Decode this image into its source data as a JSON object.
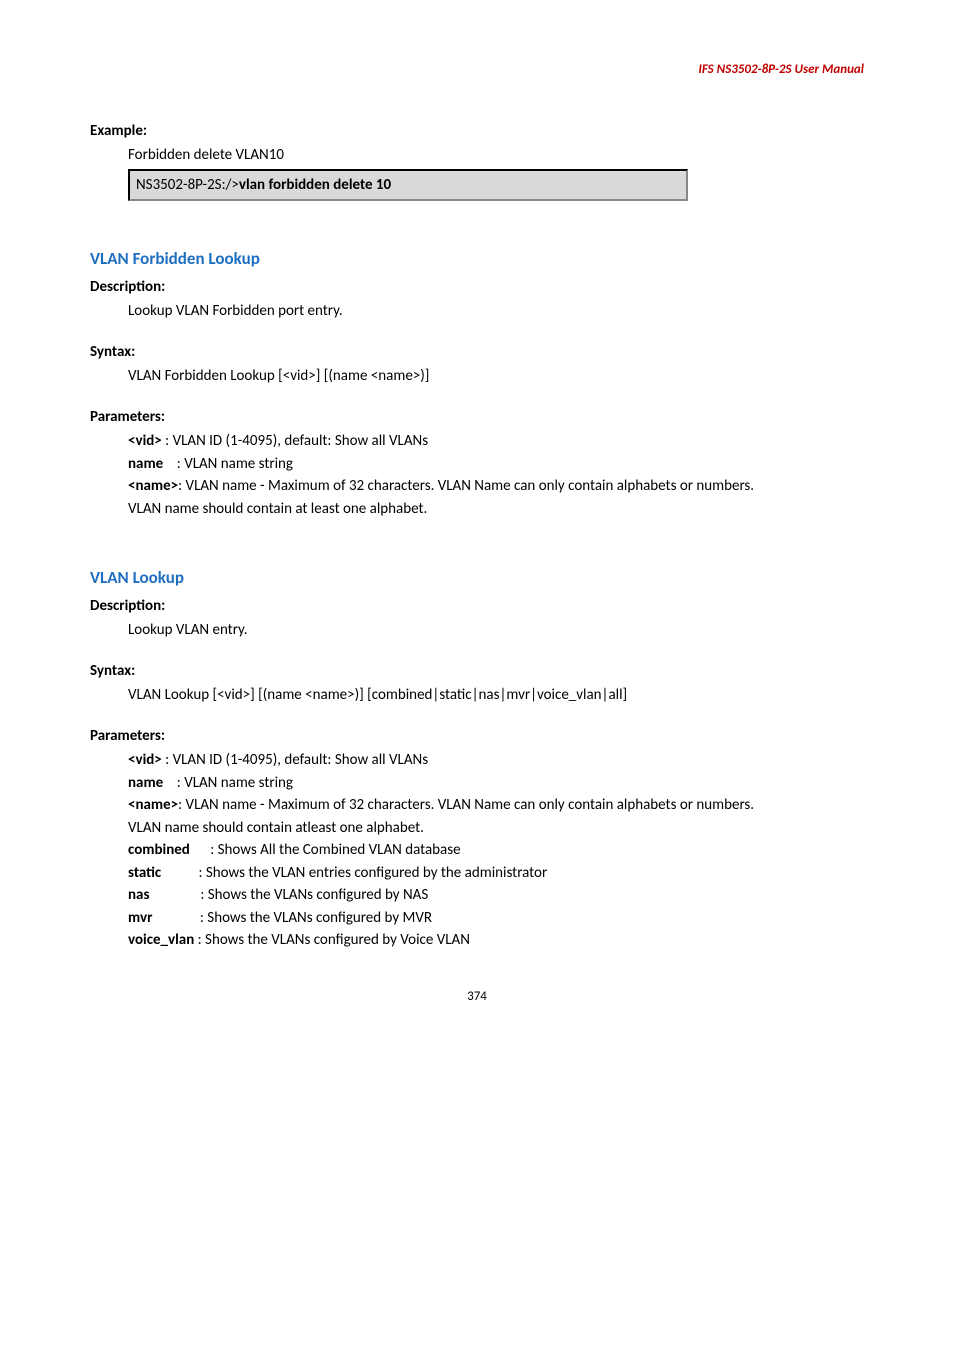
{
  "header": "IFS  NS3502-8P-2S  User  Manual",
  "exampleLabel": "Example:",
  "exampleText": "Forbidden delete VLAN10",
  "codeBoxPrefix": "NS3502-8P-2S:/>",
  "codeBoxCmd": "vlan forbidden delete 10",
  "sec1": {
    "title": "VLAN Forbidden Lookup",
    "descLabel": "Description:",
    "descText": "Lookup VLAN Forbidden port entry.",
    "syntaxLabel": "Syntax:",
    "syntaxText": "VLAN Forbidden Lookup [<vid>] [(name <name>)]",
    "paramLabel": "Parameters:",
    "p1k": "<vid>",
    "p1v": " : VLAN ID (1-4095), default: Show all VLANs",
    "p2k": "name",
    "p2v": "    : VLAN name string",
    "p3k": "<name>",
    "p3v": ": VLAN name - Maximum of 32 characters. VLAN Name can only contain alphabets or numbers.",
    "p4": "VLAN name should contain at least one alphabet."
  },
  "sec2": {
    "title": "VLAN Lookup",
    "descLabel": "Description:",
    "descText": "Lookup VLAN entry.",
    "syntaxLabel": "Syntax:",
    "syntaxText": "VLAN Lookup [<vid>] [(name <name>)] [combined|static|nas|mvr|voice_vlan|all]",
    "paramLabel": "Parameters:",
    "p1k": "<vid>",
    "p1v": " : VLAN ID (1-4095), default: Show all VLANs",
    "p2k": "name",
    "p2v": "    : VLAN name string",
    "p3k": "<name>",
    "p3v": ": VLAN name - Maximum of 32 characters. VLAN Name can only contain alphabets or numbers.",
    "p4": "VLAN name should contain atleast one alphabet.",
    "p5k": "combined",
    "p5v": "      : Shows All the Combined VLAN database",
    "p6k": "static",
    "p6v": "           : Shows the VLAN entries configured by the administrator",
    "p7k": "nas",
    "p7v": "               : Shows the VLANs configured by NAS",
    "p8k": "mvr",
    "p8v": "              : Shows the VLANs configured by MVR",
    "p9k": "voice_vlan",
    "p9v": " : Shows the VLANs configured by Voice VLAN"
  },
  "pageNum": "374"
}
